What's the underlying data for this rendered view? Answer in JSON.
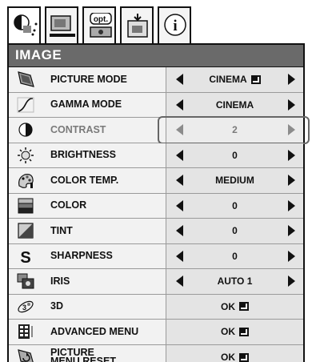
{
  "tabs": [
    {
      "icon": "image-tab-icon",
      "active": true
    },
    {
      "icon": "picture-tab-icon"
    },
    {
      "icon": "opt-tab-icon",
      "text": "opt."
    },
    {
      "icon": "install-tab-icon"
    },
    {
      "icon": "info-tab-icon",
      "text": "i"
    }
  ],
  "title": "IMAGE",
  "enter_symbol": "enter-icon",
  "rows": [
    {
      "icon": "picture-mode-icon",
      "label": "PICTURE MODE",
      "value": "CINEMA",
      "arrows": true,
      "enter": true
    },
    {
      "icon": "gamma-mode-icon",
      "label": "GAMMA MODE",
      "value": "CINEMA",
      "arrows": true
    },
    {
      "icon": "contrast-icon",
      "label": "CONTRAST",
      "value": "2",
      "arrows": true,
      "dimmed": true,
      "selected": true
    },
    {
      "icon": "brightness-icon",
      "label": "BRIGHTNESS",
      "value": "0",
      "arrows": true
    },
    {
      "icon": "color-temp-icon",
      "label": "COLOR TEMP.",
      "value": "MEDIUM",
      "arrows": true
    },
    {
      "icon": "color-icon",
      "label": "COLOR",
      "value": "0",
      "arrows": true
    },
    {
      "icon": "tint-icon",
      "label": "TINT",
      "value": "0",
      "arrows": true
    },
    {
      "icon": "sharpness-icon",
      "label": "SHARPNESS",
      "value": "0",
      "arrows": true
    },
    {
      "icon": "iris-icon",
      "label": "IRIS",
      "value": "AUTO 1",
      "arrows": true
    },
    {
      "icon": "3d-icon",
      "label": "3D",
      "value": "OK",
      "enter": true
    },
    {
      "icon": "advanced-menu-icon",
      "label": "ADVANCED MENU",
      "value": "OK",
      "enter": true
    },
    {
      "icon": "picture-menu-reset-icon",
      "label": "PICTURE MENU RESET",
      "value": "OK",
      "enter": true
    }
  ]
}
